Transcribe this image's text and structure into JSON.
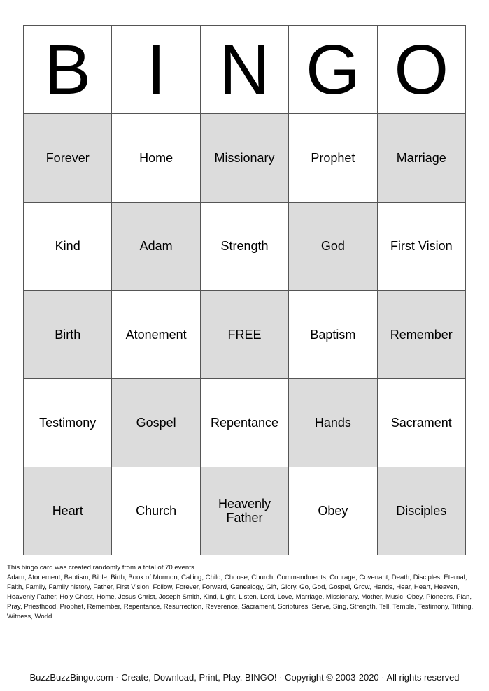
{
  "header": [
    "B",
    "I",
    "N",
    "G",
    "O"
  ],
  "rows": [
    [
      {
        "text": "Forever",
        "shaded": true
      },
      {
        "text": "Home",
        "shaded": false
      },
      {
        "text": "Missionary",
        "shaded": true
      },
      {
        "text": "Prophet",
        "shaded": false
      },
      {
        "text": "Marriage",
        "shaded": true
      }
    ],
    [
      {
        "text": "Kind",
        "shaded": false
      },
      {
        "text": "Adam",
        "shaded": true
      },
      {
        "text": "Strength",
        "shaded": false
      },
      {
        "text": "God",
        "shaded": true
      },
      {
        "text": "First Vision",
        "shaded": false
      }
    ],
    [
      {
        "text": "Birth",
        "shaded": true
      },
      {
        "text": "Atonement",
        "shaded": false
      },
      {
        "text": "FREE",
        "shaded": true
      },
      {
        "text": "Baptism",
        "shaded": false
      },
      {
        "text": "Remember",
        "shaded": true
      }
    ],
    [
      {
        "text": "Testimony",
        "shaded": false
      },
      {
        "text": "Gospel",
        "shaded": true
      },
      {
        "text": "Repentance",
        "shaded": false
      },
      {
        "text": "Hands",
        "shaded": true
      },
      {
        "text": "Sacrament",
        "shaded": false
      }
    ],
    [
      {
        "text": "Heart",
        "shaded": true
      },
      {
        "text": "Church",
        "shaded": false
      },
      {
        "text": "Heavenly Father",
        "shaded": true
      },
      {
        "text": "Obey",
        "shaded": false
      },
      {
        "text": "Disciples",
        "shaded": true
      }
    ]
  ],
  "colors": {
    "shade": "#dcdcdc",
    "border": "#555555"
  },
  "info": {
    "intro": "This bingo card was created randomly from a total of 70 events.",
    "events": "Adam, Atonement, Baptism, Bible, Birth, Book of Mormon, Calling, Child, Choose, Church, Commandments, Courage, Covenant, Death, Disciples, Eternal, Faith, Family, Family history, Father, First Vision, Follow, Forever, Forward, Genealogy, Gift, Glory, Go, God, Gospel, Grow, Hands, Hear, Heart, Heaven, Heavenly Father, Holy Ghost, Home, Jesus Christ, Joseph Smith, Kind, Light, Listen, Lord, Love, Marriage, Missionary, Mother, Music, Obey, Pioneers, Plan, Pray, Priesthood, Prophet, Remember, Repentance, Resurrection, Reverence, Sacrament, Scriptures, Serve, Sing, Strength, Tell, Temple, Testimony, Tithing, Witness, World."
  },
  "footer": "BuzzBuzzBingo.com · Create, Download, Print, Play, BINGO! · Copyright © 2003-2020 · All rights reserved"
}
